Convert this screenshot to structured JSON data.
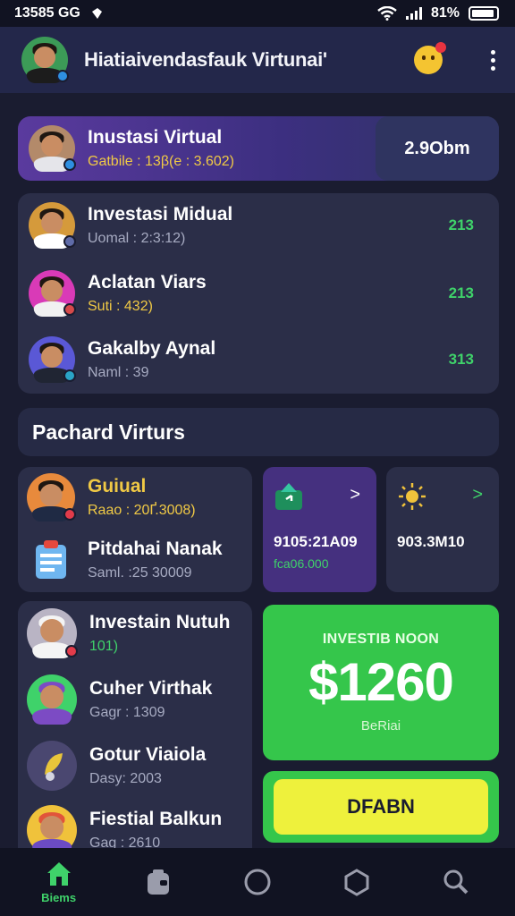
{
  "status_bar": {
    "time": "13585 GG",
    "battery": "81%"
  },
  "header": {
    "title": "Hiatiaivendasfauk Virtunai'"
  },
  "featured": {
    "name": "Inustasi Virtual",
    "detail": "Gatbile : 13β(e : 3.602)",
    "value": "2.9Obm"
  },
  "list_top": [
    {
      "name": "Investasi Midual",
      "detail": "Uomal : 2:3:12)",
      "value": "213",
      "detail_color": "gray"
    },
    {
      "name": "Aclatan Viars",
      "detail": "Suti : 432)",
      "value": "213",
      "detail_color": "yellow"
    },
    {
      "name": "Gakalby Aynal",
      "detail": "Naml : 39",
      "value": "313",
      "detail_color": "gray"
    }
  ],
  "section": {
    "title": "Pachard Virturs"
  },
  "list_mid": [
    {
      "name": "Guiual",
      "detail": "Raao : 20Ґ.3008)"
    },
    {
      "name": "Pitdahai Nanak",
      "detail": "Saml. :25 30009"
    }
  ],
  "tiles": [
    {
      "value": "9105:2‌1A09",
      "sub": "fca06.000",
      "icon": "wallet-icon"
    },
    {
      "value": "903.3M10",
      "sub": "",
      "icon": "sun-icon"
    }
  ],
  "list_bottom": [
    {
      "name": "Investain Nutuh",
      "detail": "101)"
    },
    {
      "name": "Cuher Virthak",
      "detail": "Gagr : 1309"
    },
    {
      "name": "Gotur Viaiola",
      "detail": "Dasy: 2003"
    },
    {
      "name": "Fiestial Balkun",
      "detail": "Gag : 2610"
    }
  ],
  "promo": {
    "label": "INVESTIB NOON",
    "value": "$1260",
    "sub": "BeRiai"
  },
  "cta": {
    "label": "DFABN"
  },
  "nav": [
    {
      "label": "Biems",
      "icon": "home-icon"
    },
    {
      "label": "",
      "icon": "wallet-icon"
    },
    {
      "label": "",
      "icon": "circle-icon"
    },
    {
      "label": "",
      "icon": "hexagon-icon"
    },
    {
      "label": "",
      "icon": "search-icon"
    }
  ],
  "colors": {
    "background": "#1a1c30",
    "card": "#2b2e48",
    "accent_green": "#35c64b",
    "value_green": "#3fd26a",
    "cta_yellow": "#eef13c",
    "purple": "#5a3a9e"
  }
}
